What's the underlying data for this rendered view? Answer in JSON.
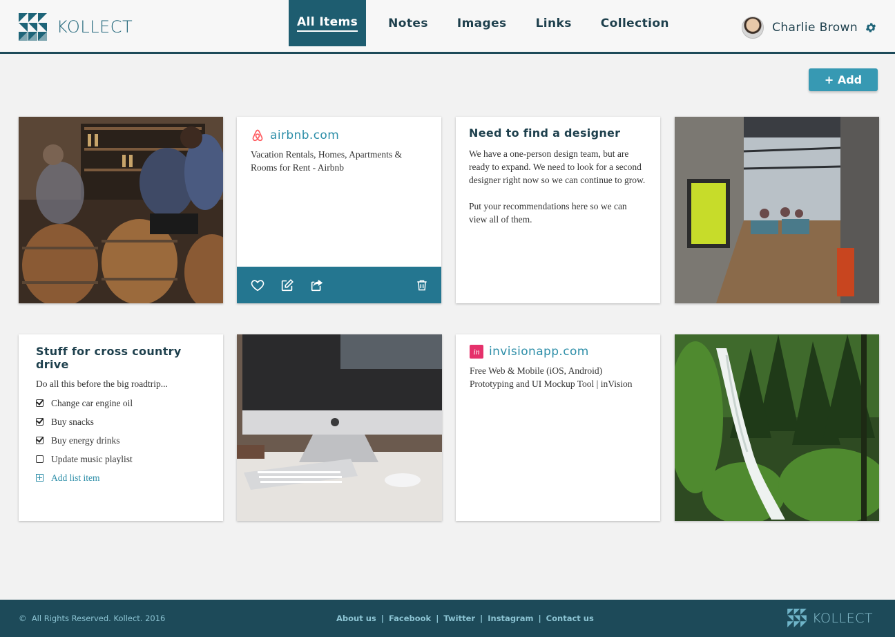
{
  "brand": {
    "name": "KOLLECT"
  },
  "nav": {
    "items": [
      "All Items",
      "Notes",
      "Images",
      "Links",
      "Collection"
    ],
    "active": "All Items"
  },
  "user": {
    "name": "Charlie Brown"
  },
  "toolbar": {
    "add_label": "+ Add"
  },
  "cards": {
    "airbnb": {
      "domain": "airbnb.com",
      "description": "Vacation Rentals, Homes, Apartments & Rooms for Rent - Airbnb"
    },
    "designer_note": {
      "title": "Need to find a designer",
      "para1": "We have a one-person design team, but are ready to expand.  We need to look for a second designer right now so we can continue to grow.",
      "para2": "Put your recommendations here so we can view all of them."
    },
    "checklist": {
      "title": "Stuff for cross country drive",
      "subtitle": "Do all this before the big roadtrip...",
      "items": [
        {
          "label": "Change car engine oil",
          "checked": true
        },
        {
          "label": "Buy snacks",
          "checked": true
        },
        {
          "label": "Buy energy drinks",
          "checked": true
        },
        {
          "label": "Update music playlist",
          "checked": false
        }
      ],
      "add_label": "Add list item"
    },
    "invision": {
      "domain": "invisionapp.com",
      "description": "Free Web & Mobile (iOS, Android) Prototyping and UI Mockup Tool | inVision"
    }
  },
  "footer": {
    "copyright": "All Rights Reserved.  Kollect. 2016",
    "links": [
      "About us",
      "Facebook",
      "Twitter",
      "Instagram",
      "Contact us"
    ],
    "brand": "KOLLECT"
  },
  "colors": {
    "header_dark": "#1d4a59",
    "accent": "#3799b3",
    "active_nav": "#1e5d70",
    "link": "#2d8ea8",
    "action_bar": "#247690"
  },
  "icons": [
    "kollect-logo",
    "avatar",
    "gear-icon",
    "airbnb-icon",
    "heart-icon",
    "edit-icon",
    "share-icon",
    "trash-icon",
    "invision-icon",
    "checkbox-icon",
    "plus-square-icon"
  ]
}
